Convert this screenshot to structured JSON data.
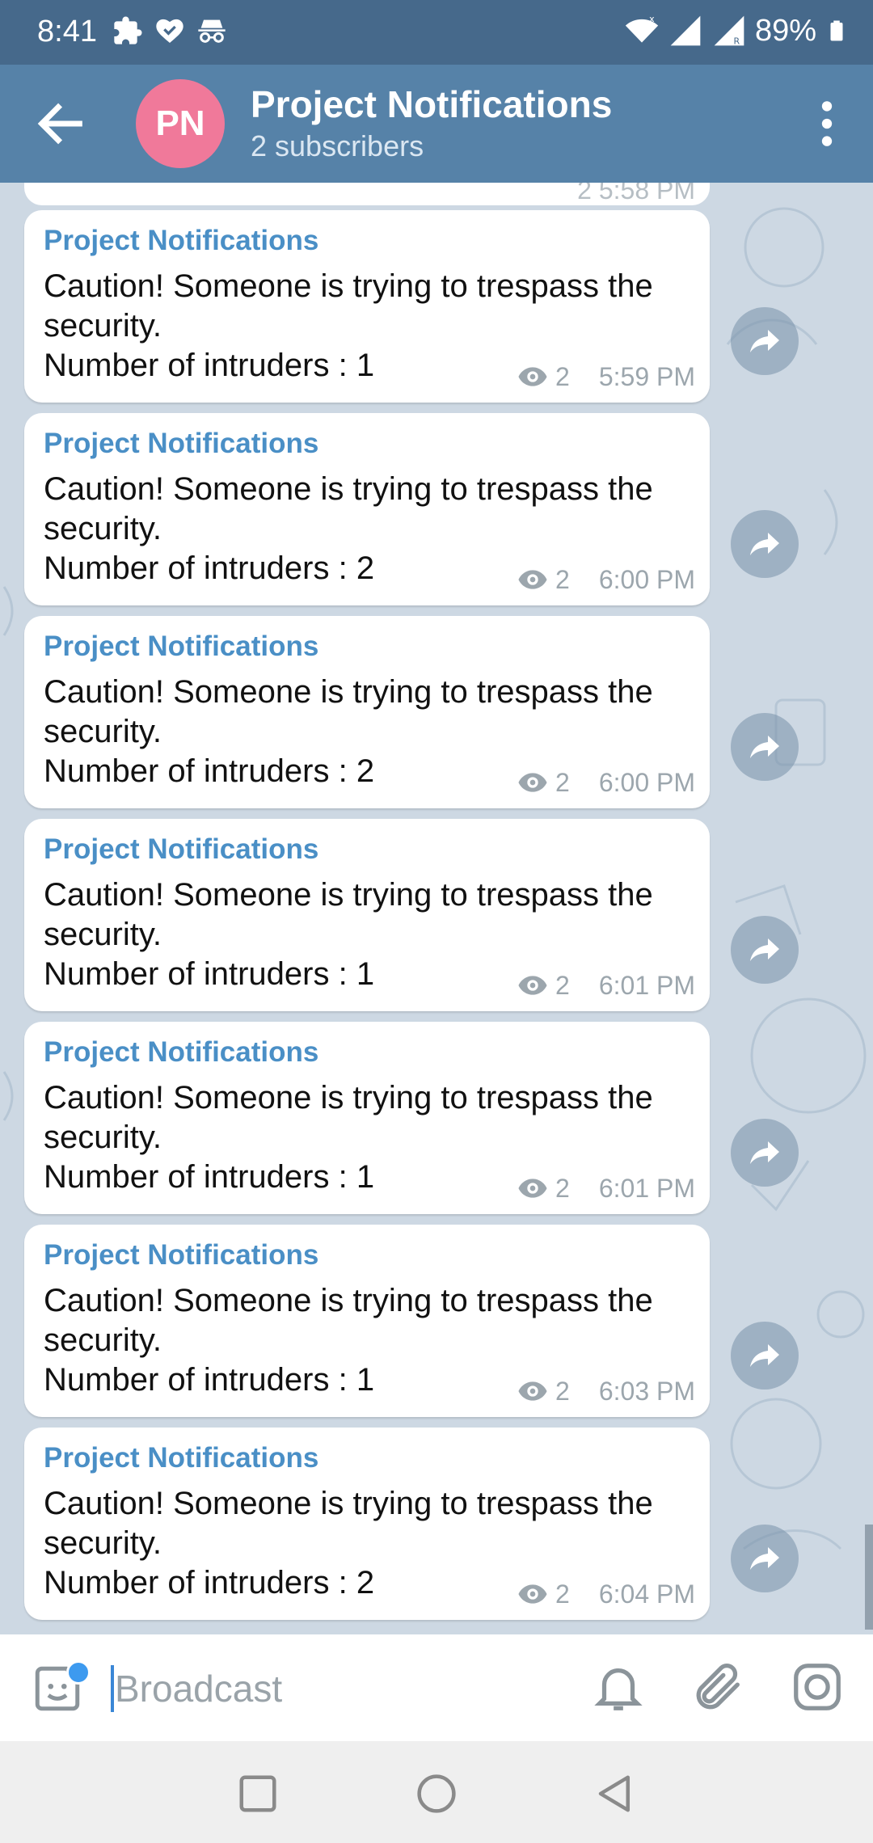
{
  "status_bar": {
    "time": "8:41",
    "battery": "89%",
    "left_icons": [
      "puzzle-icon",
      "heart-check-icon",
      "incognito-icon"
    ],
    "right_icons": [
      "wifi-icon",
      "signal-x-icon",
      "signal-r-icon",
      "battery-icon"
    ]
  },
  "header": {
    "avatar_initials": "PN",
    "avatar_color": "#f0799a",
    "title": "Project Notifications",
    "subtitle": "2 subscribers",
    "bar_color": "#5682a8"
  },
  "messages": [
    {
      "author": "Project Notifications",
      "line1": "Caution! Someone is trying to trespass the",
      "line2": "security.",
      "line3": "Number of intruders : 1",
      "views": "2",
      "time": "5:59 PM"
    },
    {
      "author": "Project Notifications",
      "line1": "Caution! Someone is trying to trespass the",
      "line2": "security.",
      "line3": "Number of intruders : 2",
      "views": "2",
      "time": "6:00 PM"
    },
    {
      "author": "Project Notifications",
      "line1": "Caution! Someone is trying to trespass the",
      "line2": "security.",
      "line3": "Number of intruders : 2",
      "views": "2",
      "time": "6:00 PM"
    },
    {
      "author": "Project Notifications",
      "line1": "Caution! Someone is trying to trespass the",
      "line2": "security.",
      "line3": "Number of intruders : 1",
      "views": "2",
      "time": "6:01 PM"
    },
    {
      "author": "Project Notifications",
      "line1": "Caution! Someone is trying to trespass the",
      "line2": "security.",
      "line3": "Number of intruders : 1",
      "views": "2",
      "time": "6:01 PM"
    },
    {
      "author": "Project Notifications",
      "line1": "Caution! Someone is trying to trespass the",
      "line2": "security.",
      "line3": "Number of intruders : 1",
      "views": "2",
      "time": "6:03 PM"
    },
    {
      "author": "Project Notifications",
      "line1": "Caution! Someone is trying to trespass the",
      "line2": "security.",
      "line3": "Number of intruders : 2",
      "views": "2",
      "time": "6:04 PM"
    }
  ],
  "partial_message": {
    "meta": "2  5:58 PM"
  },
  "compose": {
    "placeholder": "Broadcast",
    "accent": "#3d9aef"
  },
  "colors": {
    "status_bar": "#46698b",
    "author_name": "#4a8fc6",
    "chat_background": "#cdd8e3"
  }
}
